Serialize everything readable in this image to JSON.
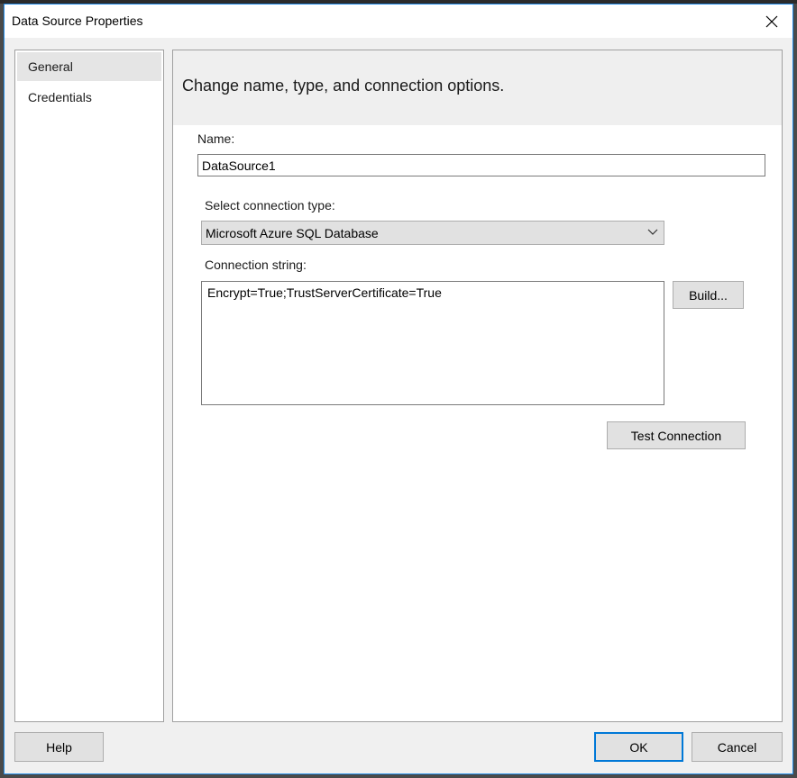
{
  "window": {
    "title": "Data Source Properties"
  },
  "icons": {
    "close": "close-icon",
    "dropdown": "chevron-down-icon"
  },
  "nav": {
    "items": [
      {
        "label": "General",
        "selected": true
      },
      {
        "label": "Credentials",
        "selected": false
      }
    ]
  },
  "content": {
    "header": "Change name, type, and connection options.",
    "name_label": "Name:",
    "name_value": "DataSource1",
    "connection_type_label": "Select connection type:",
    "connection_type_value": "Microsoft Azure SQL Database",
    "connection_string_label": "Connection string:",
    "connection_string_value": "Encrypt=True;TrustServerCertificate=True",
    "build_button": "Build...",
    "test_connection_button": "Test Connection"
  },
  "footer": {
    "help_button": "Help",
    "ok_button": "OK",
    "cancel_button": "Cancel"
  },
  "colors": {
    "accent": "#0078d7",
    "dialog_bg": "#f0f0f0",
    "button_bg": "#e1e1e1"
  }
}
